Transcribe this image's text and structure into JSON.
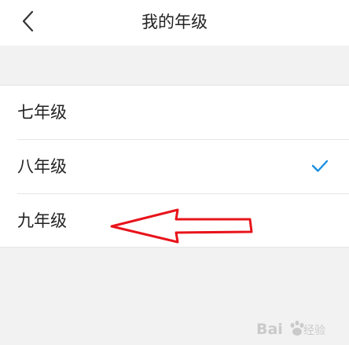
{
  "header": {
    "title": "我的年级",
    "back_icon": "chevron-left-icon"
  },
  "grades": {
    "items": [
      {
        "label": "七年级",
        "selected": false
      },
      {
        "label": "八年级",
        "selected": true
      },
      {
        "label": "九年级",
        "selected": false
      }
    ],
    "check_icon": "checkmark-icon",
    "check_color": "#1a8fe0"
  },
  "annotation": {
    "type": "arrow-pointing-left",
    "color": "#e8141b"
  },
  "colors": {
    "background": "#f2f2f2",
    "surface": "#ffffff",
    "text": "#222222",
    "divider": "#e6e6e6"
  }
}
